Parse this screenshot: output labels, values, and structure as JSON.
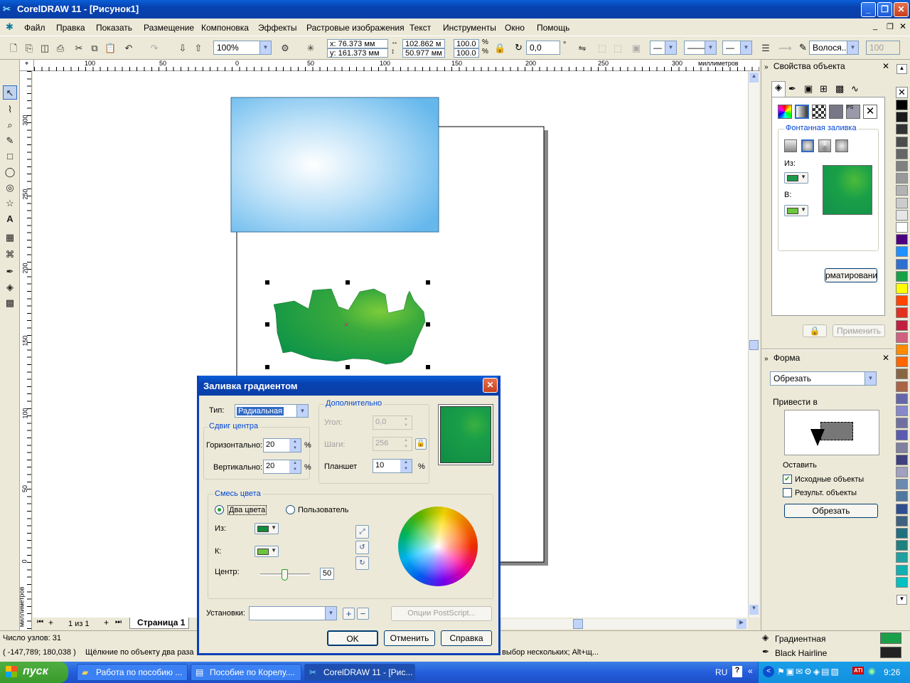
{
  "app": {
    "title": "CorelDRAW 11 - [Рисунок1]",
    "menu": [
      "Файл",
      "Правка",
      "Показать",
      "Размещение",
      "Компоновка",
      "Эффекты",
      "Растровые изображения",
      "Текст",
      "Инструменты",
      "Окно",
      "Помощь"
    ]
  },
  "toolbar": {
    "zoom": "100%",
    "x": "x: 76.373 мм",
    "y": "y: 161.373 мм",
    "w": "102.862 м",
    "h": "50.977 мм",
    "scale_x": "100.0",
    "scale_y": "100.0",
    "pct": "%",
    "rotation": "0,0",
    "deg": "°",
    "outline_width": "Волося...",
    "opacity": "100"
  },
  "ruler": {
    "units": "миллиметров",
    "h_ticks": [
      "100",
      "50",
      "0",
      "50",
      "100",
      "150",
      "200",
      "250",
      "300"
    ],
    "v_ticks": [
      "300",
      "250",
      "200",
      "150",
      "100",
      "50",
      "0"
    ],
    "v_units": "миллиметров"
  },
  "page_nav": {
    "counter": "1 из 1",
    "tab": "Страница 1"
  },
  "docker": {
    "props_title": "Свойства объекта",
    "fountain_label": "Фонтанная заливка",
    "from_label": "Из:",
    "to_label": "В:",
    "format_btn": "рматировани",
    "apply_btn": "Применить",
    "shape_title": "Форма",
    "shape_mode": "Обрезать",
    "apply_to": "Привести в",
    "keep": "Оставить",
    "src_objects": "Исходные объекты",
    "result_objects": "Результ. объекты",
    "trim_btn": "Обрезать",
    "from_color": "#1a9a4a",
    "to_color": "#6cc83c"
  },
  "status": {
    "nodes": "Число узлов: 31",
    "coords": "( -147,789; 180,038 )",
    "hint": "Щёлкние по объекту два раза",
    "hint2": "выбор нескольких; Alt+щ...",
    "fill_name": "Градиентная",
    "outline_name": "Black  Hairline",
    "fill_color": "#1aa048",
    "outline_color": "#222222"
  },
  "dialog": {
    "title": "Заливка градиентом",
    "type_label": "Тип:",
    "type_value": "Радиальная",
    "center_group": "Сдвиг центра",
    "horiz_label": "Горизонтально:",
    "horiz_value": "20",
    "vert_label": "Вертикально:",
    "vert_value": "20",
    "pct": "%",
    "extra_group": "Дополнительно",
    "angle_label": "Угол:",
    "angle_value": "0,0",
    "steps_label": "Шаги:",
    "steps_value": "256",
    "pad_label": "Планшет",
    "pad_value": "10",
    "blend_group": "Смесь цвета",
    "two_colors": "Два цвета",
    "custom": "Пользователь",
    "from_label": "Из:",
    "to_label": "К:",
    "mid_label": "Центр:",
    "mid_value": "50",
    "presets_label": "Установки:",
    "postscript_btn": "Опции PostScript...",
    "ok": "OK",
    "cancel": "Отменить",
    "help": "Справка",
    "from_color": "#138a3c",
    "to_color": "#6ec43c"
  },
  "taskbar": {
    "start": "пуск",
    "tasks": [
      "Работа по пособию ...",
      "Пособие по Корелу....",
      "CorelDRAW 11 - [Рис..."
    ],
    "lang": "RU",
    "time": "9:26"
  },
  "palette": [
    "#000000",
    "#1a1a1a",
    "#333333",
    "#4d4d4d",
    "#666666",
    "#808080",
    "#999999",
    "#b3b3b3",
    "#cccccc",
    "#e6e6e6",
    "#ffffff",
    "#4b0082",
    "#1e90ff",
    "#2f6fd0",
    "#1aa048",
    "#ffff00",
    "#ff4500",
    "#e03020",
    "#c02040",
    "#d06080",
    "#ff8c00",
    "#ff6600",
    "#886644",
    "#aa6644",
    "#6666aa",
    "#8888cc",
    "#7070a0",
    "#5a5ab0",
    "#8080a0",
    "#404080",
    "#a0a0c0",
    "#6a8ab0",
    "#5078a0",
    "#2f4f8f",
    "#406080",
    "#207080",
    "#208080",
    "#20a0a0",
    "#10b0b0",
    "#00c0c0"
  ]
}
